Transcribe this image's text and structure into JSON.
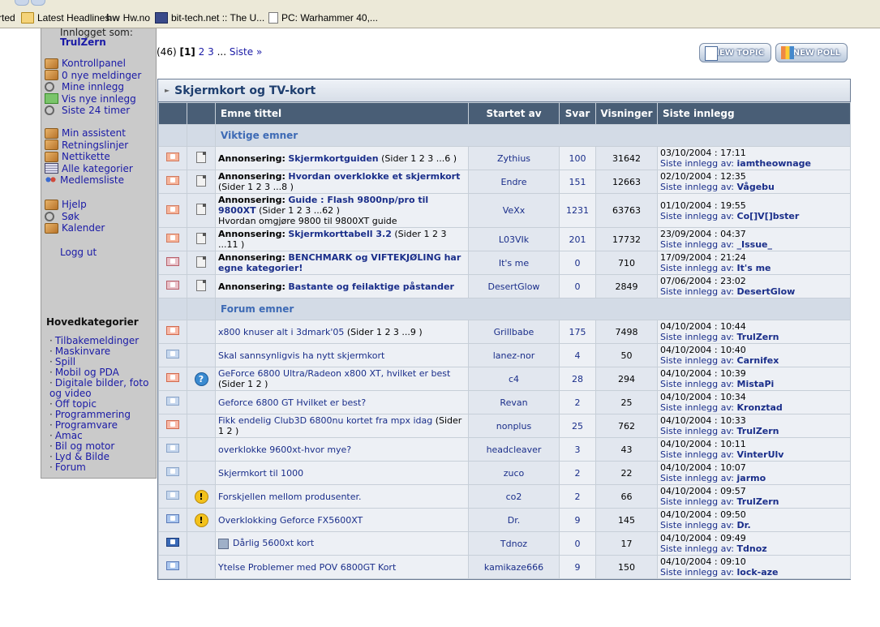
{
  "browser": {
    "bookmarks": [
      {
        "label": "rted",
        "icon": "none"
      },
      {
        "label": "Latest Headlines",
        "icon": "folder-icon"
      },
      {
        "label": "Hw.no",
        "icon": "hw-icon"
      },
      {
        "label": "bit-tech.net :: The U...",
        "icon": "pc-icon"
      },
      {
        "label": "PC: Warhammer 40,...",
        "icon": "page-icon"
      }
    ]
  },
  "sidebar": {
    "logged_in_label": "Innlogget som:",
    "username": "TrulZern",
    "menu1": [
      "Kontrollpanel",
      "0 nye meldinger",
      "Mine innlegg",
      "Vis nye innlegg",
      "Siste 24 timer"
    ],
    "menu2": [
      "Min assistent",
      "Retningslinjer",
      "Nettikette",
      "Alle kategorier",
      "Medlemsliste"
    ],
    "menu3": [
      "Hjelp",
      "Søk",
      "Kalender"
    ],
    "logout": "Logg ut",
    "categories_title": "Hovedkategorier",
    "categories": [
      "Tilbakemeldinger",
      "Maskinvare",
      "Spill",
      "Mobil og PDA",
      "Digitale bilder, foto og video",
      "Off topic",
      "Programmering",
      "Programvare",
      "Amac",
      "Bil og motor",
      "Lyd & Bilde",
      "Forum"
    ]
  },
  "pager": {
    "count": "(46)",
    "current": "[1]",
    "p2": "2",
    "p3": "3",
    "ellipsis": "...",
    "last": "Siste »"
  },
  "buttons": {
    "new_topic": "NEW TOPIC",
    "new_poll": "NEW POLL"
  },
  "forum": {
    "title": "Skjermkort og TV-kort",
    "columns": {
      "topic": "Emne tittel",
      "started_by": "Startet av",
      "replies": "Svar",
      "views": "Visninger",
      "last_post": "Siste innlegg"
    },
    "section_important": "Viktige emner",
    "section_forum": "Forum emner",
    "last_by_label": "Siste innlegg av:",
    "announce_label": "Annonsering:",
    "pages_label": "Sider",
    "important": [
      {
        "title": "Skjermkortguiden",
        "pages": "(Sider 1 2 3 ...6 )",
        "sub": "",
        "author": "Zythius",
        "replies": "100",
        "views": "31642",
        "date": "03/10/2004 : 17:11",
        "last_by": "iamtheownage",
        "icon": "hot"
      },
      {
        "title": "Hvordan overklokke et skjermkort",
        "pages": "(Sider 1 2 3 ...8 )",
        "sub": "",
        "author": "Endre",
        "replies": "151",
        "views": "12663",
        "date": "02/10/2004 : 12:35",
        "last_by": "Vågebu",
        "icon": "hot"
      },
      {
        "title": "Guide : Flash 9800np/pro til 9800XT",
        "pages": "(Sider 1 2 3 ...62 )",
        "sub": "Hvordan omgjøre 9800 til 9800XT guide",
        "author": "VeXx",
        "replies": "1231",
        "views": "63763",
        "date": "01/10/2004 : 19:55",
        "last_by": "Co[]V[]bster",
        "icon": "hot"
      },
      {
        "title": "Skjermkorttabell 3.2",
        "pages": "(Sider 1 2 3 ...11 )",
        "sub": "",
        "author": "L03VIk",
        "replies": "201",
        "views": "17732",
        "date": "23/09/2004 : 04:37",
        "last_by": "_Issue_",
        "icon": "hot"
      },
      {
        "title": "BENCHMARK og VIFTEKJØLING har egne kategorier!",
        "pages": "",
        "sub": "",
        "author": "It's me",
        "replies": "0",
        "views": "710",
        "date": "17/09/2004 : 21:24",
        "last_by": "It's me",
        "icon": "lock"
      },
      {
        "title": "Bastante og feilaktige påstander",
        "pages": "",
        "sub": "",
        "author": "DesertGlow",
        "replies": "0",
        "views": "2849",
        "date": "07/06/2004 : 23:02",
        "last_by": "DesertGlow",
        "icon": "lock"
      }
    ],
    "topics": [
      {
        "title": "x800 knuser alt i 3dmark'05",
        "pages": "(Sider 1 2 3 ...9 )",
        "author": "Grillbabe",
        "replies": "175",
        "views": "7498",
        "date": "04/10/2004 : 10:44",
        "last_by": "TrulZern",
        "icon": "new",
        "mood": ""
      },
      {
        "title": "Skal sannsynligvis ha nytt skjermkort",
        "pages": "",
        "author": "lanez-nor",
        "replies": "4",
        "views": "50",
        "date": "04/10/2004 : 10:40",
        "last_by": "Carnifex",
        "icon": "cold",
        "mood": ""
      },
      {
        "title": "GeForce 6800 Ultra/Radeon x800 XT, hvilket er best",
        "pages": "(Sider 1 2 )",
        "author": "c4",
        "replies": "28",
        "views": "294",
        "date": "04/10/2004 : 10:39",
        "last_by": "MistaPi",
        "icon": "new",
        "mood": "question"
      },
      {
        "title": "Geforce 6800 GT Hvilket er best?",
        "pages": "",
        "author": "Revan",
        "replies": "2",
        "views": "25",
        "date": "04/10/2004 : 10:34",
        "last_by": "Kronztad",
        "icon": "cold",
        "mood": ""
      },
      {
        "title": "Fikk endelig Club3D 6800nu kortet fra mpx idag",
        "pages": "(Sider 1 2 )",
        "author": "nonplus",
        "replies": "25",
        "views": "762",
        "date": "04/10/2004 : 10:33",
        "last_by": "TrulZern",
        "icon": "new",
        "mood": ""
      },
      {
        "title": "overklokke 9600xt-hvor mye?",
        "pages": "",
        "author": "headcleaver",
        "replies": "3",
        "views": "43",
        "date": "04/10/2004 : 10:11",
        "last_by": "VinterUlv",
        "icon": "cold",
        "mood": ""
      },
      {
        "title": "Skjermkort til 1000",
        "pages": "",
        "author": "zuco",
        "replies": "2",
        "views": "22",
        "date": "04/10/2004 : 10:07",
        "last_by": "jarmo",
        "icon": "cold",
        "mood": ""
      },
      {
        "title": "Forskjellen mellom produsenter.",
        "pages": "",
        "author": "co2",
        "replies": "2",
        "views": "66",
        "date": "04/10/2004 : 09:57",
        "last_by": "TrulZern",
        "icon": "cold",
        "mood": "warning"
      },
      {
        "title": "Overklokking Geforce FX5600XT",
        "pages": "",
        "author": "Dr.",
        "replies": "9",
        "views": "145",
        "date": "04/10/2004 : 09:50",
        "last_by": "Dr.",
        "icon": "blue",
        "mood": "warning"
      },
      {
        "title": "Dårlig 5600xt kort",
        "pages": "",
        "author": "Tdnoz",
        "replies": "0",
        "views": "17",
        "date": "04/10/2004 : 09:49",
        "last_by": "Tdnoz",
        "icon": "dark",
        "mood": "",
        "prefix_icon": true
      },
      {
        "title": "Ytelse Problemer med POV 6800GT Kort",
        "pages": "",
        "author": "kamikaze666",
        "replies": "9",
        "views": "150",
        "date": "04/10/2004 : 09:10",
        "last_by": "lock-aze",
        "icon": "blue",
        "mood": ""
      }
    ]
  }
}
